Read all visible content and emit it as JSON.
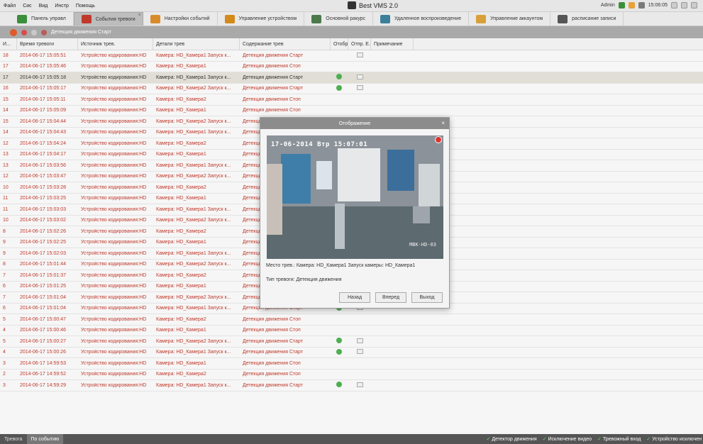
{
  "menu": [
    "Файл",
    "Сис",
    "Вид",
    "Инстр",
    "Помощь"
  ],
  "app_title": "Best VMS 2.0",
  "status": {
    "user": "Admin",
    "time": "15:06:05"
  },
  "tabs": [
    {
      "label": "Панель управл",
      "icon": "dashboard-icon",
      "color": "#3a8f3a"
    },
    {
      "label": "События тревоги",
      "icon": "alarm-icon",
      "color": "#c0392b",
      "active": true
    },
    {
      "label": "Настройки событий",
      "icon": "event-settings-icon",
      "color": "#d98b2b"
    },
    {
      "label": "Управление устройством",
      "icon": "device-icon",
      "color": "#d48a1a"
    },
    {
      "label": "Основной ракурс",
      "icon": "main-view-icon",
      "color": "#4a7a4a"
    },
    {
      "label": "Удаленное воспроизведение",
      "icon": "playback-icon",
      "color": "#3c7f9a"
    },
    {
      "label": "Управление аккаунтом",
      "icon": "account-icon",
      "color": "#d9a03a"
    },
    {
      "label": "расписание записи",
      "icon": "schedule-icon",
      "color": "#555555"
    }
  ],
  "toolbar": {
    "label": "Детекция движения Старт"
  },
  "columns": [
    "И...",
    "Время тревоги",
    "Источник трев.",
    "Детали трев",
    "Содержание трев",
    "Отобра...",
    "Отпр. Е...",
    "Примечание"
  ],
  "rows": [
    {
      "id": "18",
      "time": "2014-06-17 15:05:51",
      "src": "Устройство кодирования:HD",
      "det": "Камера: HD_Камера1 Запуск к...",
      "content": "Детекция движения Старт",
      "show": false,
      "mail": true
    },
    {
      "id": "17",
      "time": "2014-06-17 15:05:46",
      "src": "Устройство кодирования:HD",
      "det": "Камера: HD_Камера1",
      "content": "Детекция движения Стоп",
      "show": false,
      "mail": false
    },
    {
      "id": "17",
      "time": "2014-06-17 15:05:18",
      "src": "Устройство кодирования:HD",
      "det": "Камера: HD_Камера1 Запуск к...",
      "content": "Детекция движения Старт",
      "show": true,
      "mail": true,
      "selected": true
    },
    {
      "id": "16",
      "time": "2014-06-17 15:05:17",
      "src": "Устройство кодирования:HD",
      "det": "Камера: HD_Камера2 Запуск к...",
      "content": "Детекция движения Старт",
      "show": true,
      "mail": true
    },
    {
      "id": "15",
      "time": "2014-06-17 15:05:11",
      "src": "Устройство кодирования:HD",
      "det": "Камера: HD_Камера2",
      "content": "Детекция движения Стоп",
      "show": false,
      "mail": false
    },
    {
      "id": "14",
      "time": "2014-06-17 15:05:09",
      "src": "Устройство кодирования:HD",
      "det": "Камера: HD_Камера1",
      "content": "Детекция движения Стоп",
      "show": false,
      "mail": false
    },
    {
      "id": "15",
      "time": "2014-06-17 15:04:44",
      "src": "Устройство кодирования:HD",
      "det": "Камера: HD_Камера2 Запуск к...",
      "content": "Детекция движения Старт",
      "show": false,
      "mail": false
    },
    {
      "id": "14",
      "time": "2014-06-17 15:04:43",
      "src": "Устройство кодирования:HD",
      "det": "Камера: HD_Камера1 Запуск к...",
      "content": "Детекция движения Старт",
      "show": false,
      "mail": false
    },
    {
      "id": "12",
      "time": "2014-06-17 15:04:24",
      "src": "Устройство кодирования:HD",
      "det": "Камера: HD_Камера2",
      "content": "Детекция движения Стоп",
      "show": false,
      "mail": false
    },
    {
      "id": "13",
      "time": "2014-06-17 15:04:17",
      "src": "Устройство кодирования:HD",
      "det": "Камера: HD_Камера1",
      "content": "Детекция движения Стоп",
      "show": false,
      "mail": false
    },
    {
      "id": "13",
      "time": "2014-06-17 15:03:56",
      "src": "Устройство кодирования:HD",
      "det": "Камера: HD_Камера1 Запуск к...",
      "content": "Детекция движения Старт",
      "show": false,
      "mail": false
    },
    {
      "id": "12",
      "time": "2014-06-17 15:03:47",
      "src": "Устройство кодирования:HD",
      "det": "Камера: HD_Камера2 Запуск к...",
      "content": "Детекция движения Старт",
      "show": false,
      "mail": false
    },
    {
      "id": "10",
      "time": "2014-06-17 15:03:28",
      "src": "Устройство кодирования:HD",
      "det": "Камера: HD_Камера2",
      "content": "Детекция движения Стоп",
      "show": false,
      "mail": false
    },
    {
      "id": "11",
      "time": "2014-06-17 15:03:25",
      "src": "Устройство кодирования:HD",
      "det": "Камера: HD_Камера1",
      "content": "Детекция движения Стоп",
      "show": false,
      "mail": false
    },
    {
      "id": "11",
      "time": "2014-06-17 15:03:03",
      "src": "Устройство кодирования:HD",
      "det": "Камера: HD_Камера1 Запуск к...",
      "content": "Детекция движения Старт",
      "show": false,
      "mail": false
    },
    {
      "id": "10",
      "time": "2014-06-17 15:03:02",
      "src": "Устройство кодирования:HD",
      "det": "Камера: HD_Камера2 Запуск к...",
      "content": "Детекция движения Старт",
      "show": false,
      "mail": false
    },
    {
      "id": "8",
      "time": "2014-06-17 15:02:26",
      "src": "Устройство кодирования:HD",
      "det": "Камера: HD_Камера2",
      "content": "Детекция движения Стоп",
      "show": false,
      "mail": false
    },
    {
      "id": "9",
      "time": "2014-06-17 15:02:25",
      "src": "Устройство кодирования:HD",
      "det": "Камера: HD_Камера1",
      "content": "Детекция движения Стоп",
      "show": false,
      "mail": false
    },
    {
      "id": "9",
      "time": "2014-06-17 15:02:03",
      "src": "Устройство кодирования:HD",
      "det": "Камера: HD_Камера1 Запуск к...",
      "content": "Детекция движения Старт",
      "show": false,
      "mail": false
    },
    {
      "id": "8",
      "time": "2014-06-17 15:01:44",
      "src": "Устройство кодирования:HD",
      "det": "Камера: HD_Камера2 Запуск к...",
      "content": "Детекция движения Старт",
      "show": false,
      "mail": false
    },
    {
      "id": "7",
      "time": "2014-06-17 15:01:37",
      "src": "Устройство кодирования:HD",
      "det": "Камера: HD_Камера2",
      "content": "Детекция движения Стоп",
      "show": false,
      "mail": false
    },
    {
      "id": "6",
      "time": "2014-06-17 15:01:25",
      "src": "Устройство кодирования:HD",
      "det": "Камера: HD_Камера1",
      "content": "Детекция движения Стоп",
      "show": false,
      "mail": false
    },
    {
      "id": "7",
      "time": "2014-06-17 15:01:04",
      "src": "Устройство кодирования:HD",
      "det": "Камера: HD_Камера2 Запуск к...",
      "content": "Детекция движения Старт",
      "show": true,
      "mail": true
    },
    {
      "id": "6",
      "time": "2014-06-17 15:01:04",
      "src": "Устройство кодирования:HD",
      "det": "Камера: HD_Камера1 Запуск к...",
      "content": "Детекция движения Старт",
      "show": true,
      "mail": true
    },
    {
      "id": "5",
      "time": "2014-06-17 15:00:47",
      "src": "Устройство кодирования:HD",
      "det": "Камера: HD_Камера2",
      "content": "Детекция движения Стоп",
      "show": false,
      "mail": false
    },
    {
      "id": "4",
      "time": "2014-06-17 15:00:46",
      "src": "Устройство кодирования:HD",
      "det": "Камера: HD_Камера1",
      "content": "Детекция движения Стоп",
      "show": false,
      "mail": false
    },
    {
      "id": "5",
      "time": "2014-06-17 15:00:27",
      "src": "Устройство кодирования:HD",
      "det": "Камера: HD_Камера2 Запуск к...",
      "content": "Детекция движения Старт",
      "show": true,
      "mail": true
    },
    {
      "id": "4",
      "time": "2014-06-17 15:00:26",
      "src": "Устройство кодирования:HD",
      "det": "Камера: HD_Камера1 Запуск к...",
      "content": "Детекция движения Старт",
      "show": true,
      "mail": true
    },
    {
      "id": "3",
      "time": "2014-06-17 14:59:53",
      "src": "Устройство кодирования:HD",
      "det": "Камера: HD_Камера1",
      "content": "Детекция движения Стоп",
      "show": false,
      "mail": false
    },
    {
      "id": "2",
      "time": "2014-06-17 14:59:52",
      "src": "Устройство кодирования:HD",
      "det": "Камера: HD_Камера2",
      "content": "Детекция движения Стоп",
      "show": false,
      "mail": false
    },
    {
      "id": "3",
      "time": "2014-06-17 14:59:29",
      "src": "Устройство кодирования:HD",
      "det": "Камера: HD_Камера1 Запуск к...",
      "content": "Детекция движения Старт",
      "show": true,
      "mail": true
    }
  ],
  "bottom_tabs": [
    "Тревога",
    "По событию"
  ],
  "filters": [
    "Детектор движения",
    "Исключение видео",
    "Тревожный вход",
    "Устройство исключен"
  ],
  "dialog": {
    "title": "Отображение",
    "osd": "17-06-2014 Втр 15:07:01",
    "cam_tag": "MBK-HD-03",
    "place_label": "Место трев.:",
    "place_value": "Камера: HD_Камера1 Запуск камеры: HD_Камера1",
    "type_label": "Тип тревоги:",
    "type_value": "Детекция движения",
    "buttons": {
      "back": "Назад",
      "forward": "Вперед",
      "exit": "Выход"
    }
  },
  "colors": {
    "alarm_red": "#c0392b",
    "selected_row": "#e1ded6",
    "play_green": "#4caf50"
  }
}
